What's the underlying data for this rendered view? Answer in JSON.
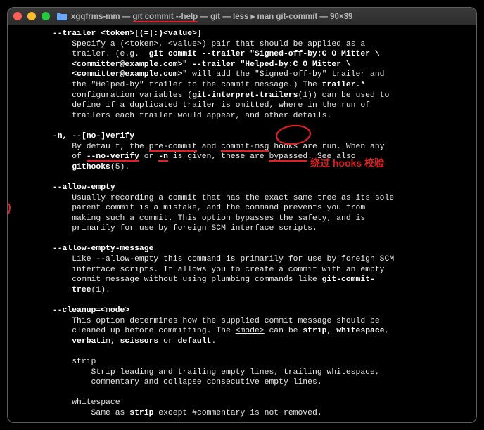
{
  "window": {
    "title_prefix": "xgqfrms-mm — ",
    "title_highlight": "git commit --help",
    "title_suffix": " — git — less ▸ man git-commit — 90×39"
  },
  "annotation": {
    "bypass_hooks": "绕过 hooks 校验"
  },
  "man": {
    "trailer": {
      "heading": "--trailer <token>[(=|:)<value>]",
      "l1a": "Specify a (<token>, <value>) pair that should be applied as a",
      "l1b": "trailer. (e.g.  ",
      "l1b_bold": "git commit --trailer \"Signed-off-by:C O Mitter \\",
      "l1c_bold": "<committer@example.com>\" --trailer \"Helped-by:C O Mitter \\",
      "l1d_bold": "<committer@example.com>\"",
      "l1d_tail": " will add the \"Signed-off-by\" trailer and",
      "l1e": "the \"Helped-by\" trailer to the commit message.) The ",
      "l1e_bold": "trailer.*",
      "l1f": "configuration variables (",
      "l1f_bold": "git-interpret-trailers",
      "l1f_tail": "(1)) can be used to",
      "l1g": "define if a duplicated trailer is omitted, where in the run of",
      "l1h": "trailers each trailer would appear, and other details."
    },
    "verify": {
      "heading": "-n, --[no-]verify",
      "l1a": "By default, the ",
      "hook_pre": "pre-commit",
      "l1b": " and ",
      "hook_msg": "commit-msg",
      "l1c": " hooks are run. When any",
      "l2a": "of ",
      "noverify": "--no-verify",
      "l2b": " or ",
      "nflag": "-n",
      "l2c": " is given, these are ",
      "bypassed": "bypassed",
      "l2d": ". See also",
      "l3a_bold": "githooks",
      "l3b": "(5)."
    },
    "allow_empty": {
      "heading": "--allow-empty",
      "l1": "Usually recording a commit that has the exact same tree as its sole",
      "l2": "parent commit is a mistake, and the command prevents you from",
      "l3": "making such a commit. This option bypasses the safety, and is",
      "l4": "primarily for use by foreign SCM interface scripts."
    },
    "allow_empty_msg": {
      "heading": "--allow-empty-message",
      "l1": "Like --allow-empty this command is primarily for use by foreign SCM",
      "l2": "interface scripts. It allows you to create a commit with an empty",
      "l3a": "commit message without using plumbing commands like ",
      "l3b_bold": "git-commit-",
      "l4a_bold": "tree",
      "l4b": "(1)."
    },
    "cleanup": {
      "heading": "--cleanup=<mode>",
      "l1": "This option determines how the supplied commit message should be",
      "l2a": "cleaned up before committing. The ",
      "l2_mode": "<mode>",
      "l2b": " can be ",
      "opt_strip": "strip",
      "sep1": ", ",
      "opt_ws": "whitespace",
      "sep2": ",",
      "l3a_bold1": "verbatim",
      "l3_sep": ", ",
      "l3a_bold2": "scissors",
      "l3b": " or ",
      "l3a_bold3": "default",
      "l3c": ".",
      "strip_h": "strip",
      "strip_l1": "Strip leading and trailing empty lines, trailing whitespace,",
      "strip_l2": "commentary and collapse consecutive empty lines.",
      "ws_h": "whitespace",
      "ws_l1a": "Same as ",
      "ws_l1b_bold": "strip",
      "ws_l1c": " except #commentary is not removed."
    }
  }
}
